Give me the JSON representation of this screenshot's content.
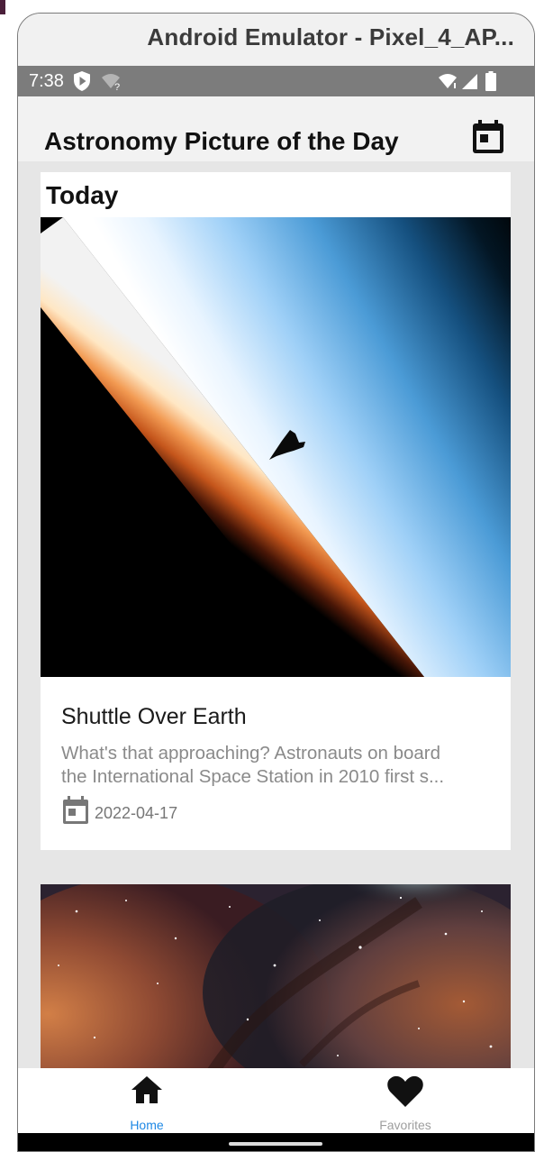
{
  "emulator": {
    "title": "Android Emulator - Pixel_4_AP..."
  },
  "status_bar": {
    "time": "7:38"
  },
  "app_bar": {
    "title": "Astronomy Picture of the Day",
    "calendar_icon": "calendar-icon"
  },
  "today": {
    "heading": "Today",
    "title": "Shuttle Over Earth",
    "description_lines": [
      "What's that approaching? Astronauts on board",
      "the International Space Station in 2010 first s..."
    ],
    "date": "2022-04-17"
  },
  "bottom_nav": {
    "items": [
      {
        "label": "Home",
        "icon": "home-icon",
        "active": true,
        "color": "#1e88e5"
      },
      {
        "label": "Favorites",
        "icon": "heart-icon",
        "active": false,
        "color": "#9e9e9e"
      }
    ]
  },
  "colors": {
    "accent": "#1e88e5",
    "status_bar": "#7c7c7c",
    "background": "#e6e6e6"
  }
}
